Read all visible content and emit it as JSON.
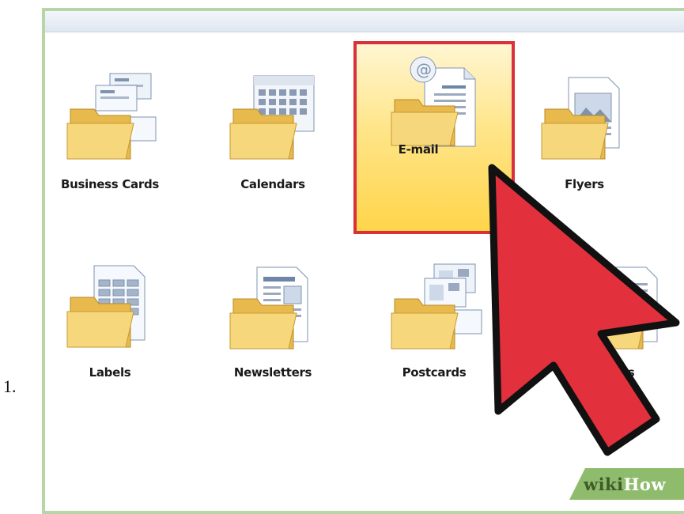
{
  "list_marker": "1.",
  "templates": [
    {
      "label": "Business Cards",
      "icon": "business-cards-icon",
      "selected": false
    },
    {
      "label": "Calendars",
      "icon": "calendar-icon",
      "selected": false
    },
    {
      "label": "E-mail",
      "icon": "email-icon",
      "selected": true
    },
    {
      "label": "Flyers",
      "icon": "flyer-icon",
      "selected": false
    },
    {
      "label": "Labels",
      "icon": "labels-icon",
      "selected": false
    },
    {
      "label": "Newsletters",
      "icon": "newsletter-icon",
      "selected": false
    },
    {
      "label": "Postcards",
      "icon": "postcard-icon",
      "selected": false
    },
    {
      "label": "tes",
      "icon": "template-icon",
      "selected": false
    }
  ],
  "colors": {
    "selection_border": "#d9303a",
    "selection_fill": "#ffd54a",
    "cursor": "#e2303c",
    "frame": "#b6d6a6"
  },
  "watermark": {
    "prefix": "wiki",
    "suffix": "How"
  }
}
